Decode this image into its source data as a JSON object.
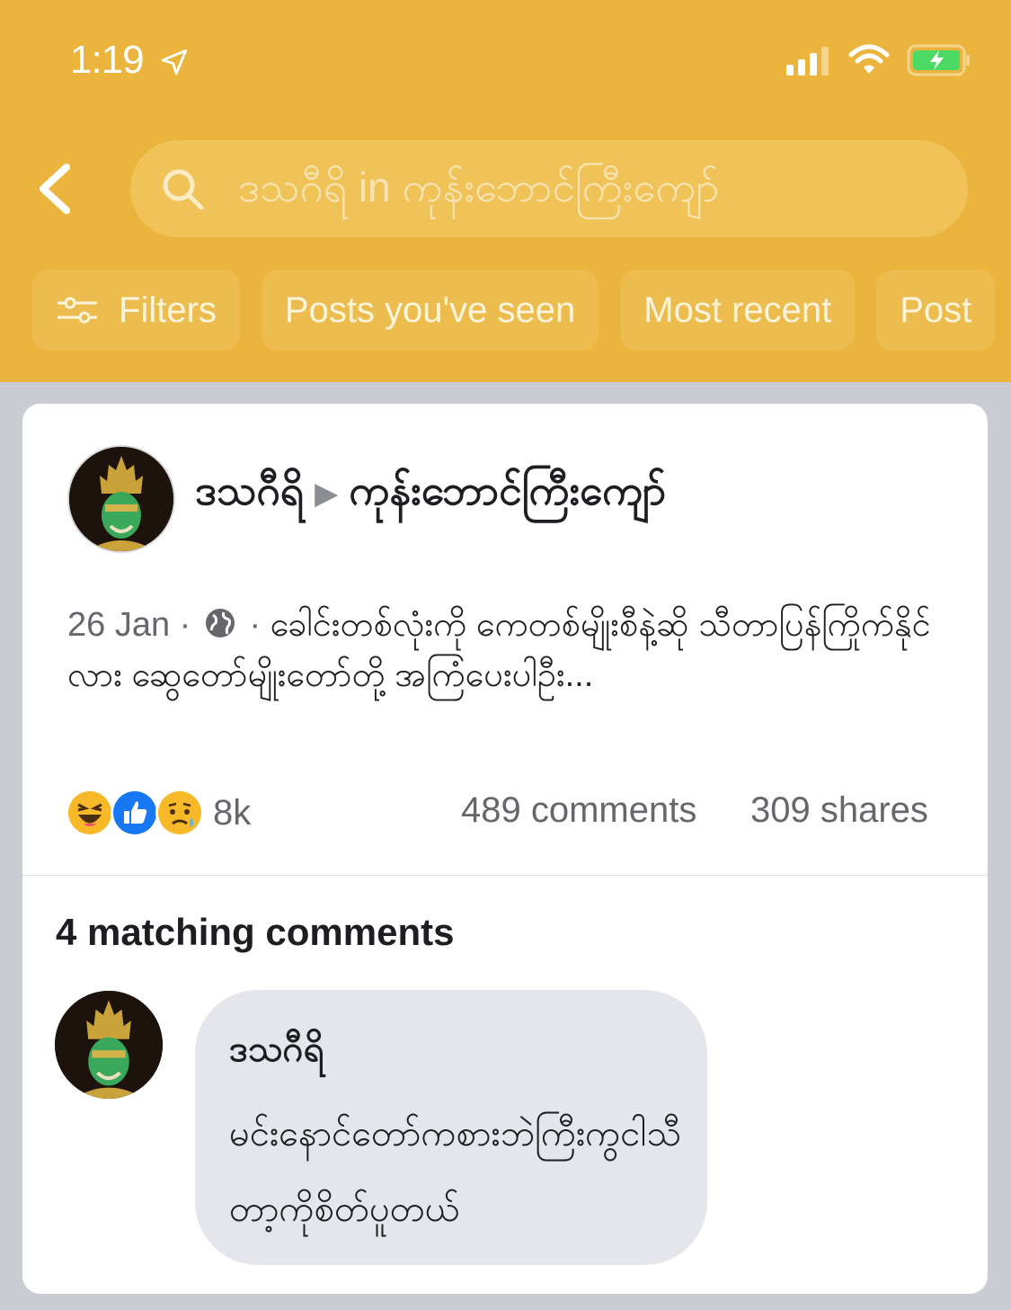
{
  "status_bar": {
    "time": "1:19"
  },
  "search": {
    "query": "ဒသဂီရိ in ကုန်းဘောင်ကြီးကျော်"
  },
  "filters": [
    {
      "label": "Filters",
      "icon": "sliders-icon"
    },
    {
      "label": "Posts you've seen"
    },
    {
      "label": "Most recent"
    },
    {
      "label": "Post"
    }
  ],
  "post": {
    "author": "ဒသဂီရိ",
    "group": "ကုန်းဘောင်ကြီးကျော်",
    "date": "26 Jan",
    "separator": "·",
    "text": "ခေါင်းတစ်လုံးကို ကေတစ်မျိုးစီနဲ့ဆို သီတာပြန်ကြိုက်နိုင်လား ဆွေတော်မျိုးတော်တို့ အကြံပေးပါဦး...",
    "reaction_count": "8k",
    "comments": "489 comments",
    "shares": "309 shares",
    "reactions": [
      "haha-icon",
      "like-icon",
      "sad-icon"
    ]
  },
  "matching": {
    "title": "4 matching comments",
    "comment": {
      "author": "ဒသဂီရိ",
      "text": "မင်းနောင်တော်ကစားဘဲကြီးကွငါသီတာ့ကိုစိတ်ပူတယ်"
    }
  },
  "colors": {
    "header": "#ebb43d",
    "card": "#ffffff",
    "bubble": "#e4e6eb"
  }
}
